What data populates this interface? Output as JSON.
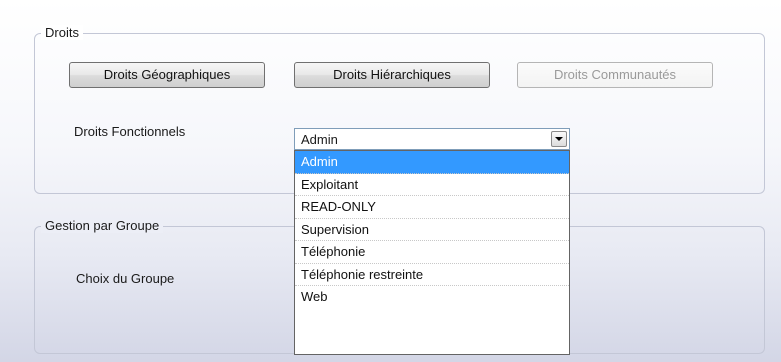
{
  "droits_group": {
    "title": "Droits",
    "buttons": {
      "geographiques": "Droits Géographiques",
      "hierarchiques": "Droits Hiérarchiques",
      "communautes": "Droits Communautés"
    },
    "fonctionnels_label": "Droits Fonctionnels",
    "fonctionnels_value": "Admin",
    "options": [
      "Admin",
      "Exploitant",
      "READ-ONLY",
      "Supervision",
      "Téléphonie",
      "Téléphonie restreinte",
      "Web"
    ],
    "selected_option": "Admin"
  },
  "gestion_group": {
    "title": "Gestion par Groupe",
    "choix_label": "Choix du Groupe"
  },
  "colors": {
    "selection": "#3399ff",
    "group_border": "#c3c7d6"
  }
}
